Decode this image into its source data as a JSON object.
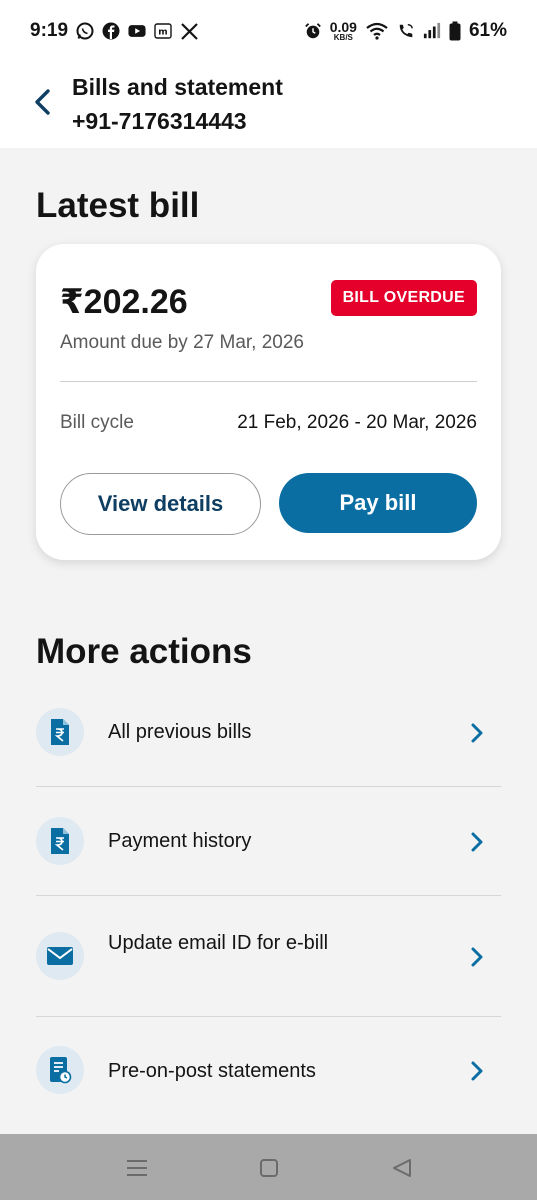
{
  "status_bar": {
    "time": "9:19",
    "net_speed_value": "0.09",
    "net_speed_unit": "KB/S",
    "battery": "61%",
    "icons": [
      "whatsapp-icon",
      "facebook-icon",
      "youtube-icon",
      "m-app-icon",
      "x-icon",
      "alarm-icon",
      "wifi-icon",
      "wifi-call-icon",
      "signal-icon",
      "battery-icon"
    ]
  },
  "header": {
    "title": "Bills and statement",
    "subtitle": "+91-7176314443"
  },
  "latest_bill": {
    "section_title": "Latest bill",
    "amount": "₹202.26",
    "badge": "BILL OVERDUE",
    "due_text": "Amount due by 27 Mar, 2026",
    "cycle_label": "Bill cycle",
    "cycle_value": "21 Feb, 2026 - 20 Mar, 2026",
    "view_details_label": "View details",
    "pay_bill_label": "Pay bill"
  },
  "more_actions": {
    "section_title": "More actions",
    "items": [
      {
        "label": "All previous bills",
        "icon": "rupee-document-icon"
      },
      {
        "label": "Payment history",
        "icon": "rupee-document-icon"
      },
      {
        "label": "Update email ID for e-bill",
        "icon": "envelope-icon"
      },
      {
        "label": "Pre-on-post statements",
        "icon": "statement-icon"
      }
    ]
  },
  "colors": {
    "accent": "#0a6ea3",
    "overdue": "#e4002b",
    "background": "#f3f3f3"
  }
}
